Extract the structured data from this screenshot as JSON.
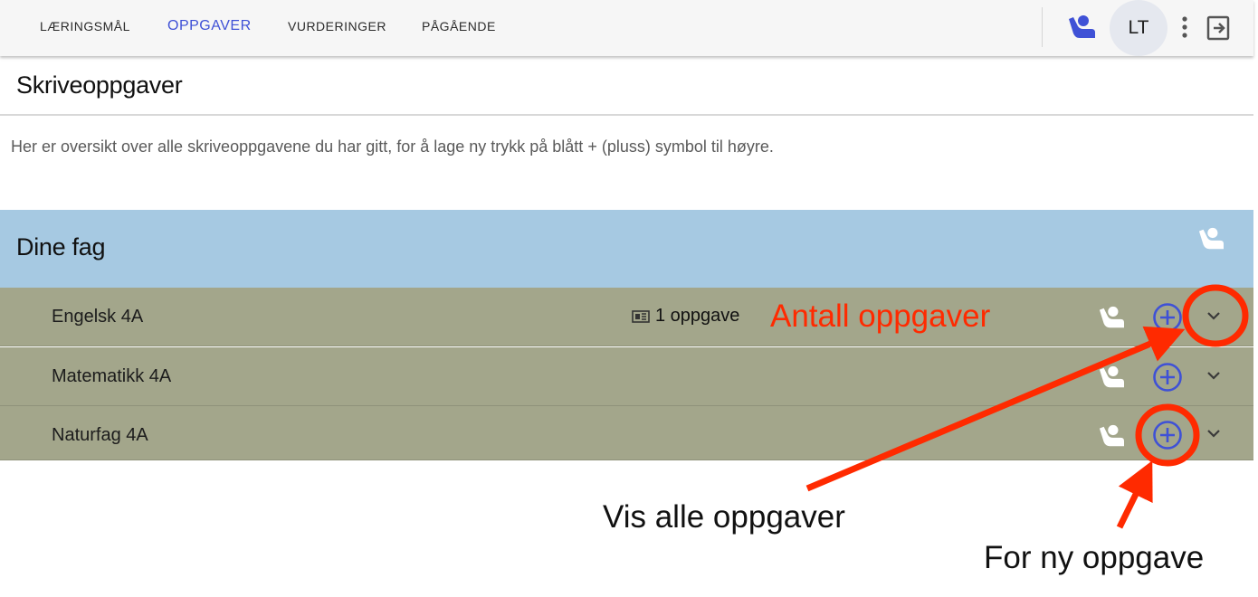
{
  "nav": {
    "tabs": [
      {
        "label": "LÆRINGSMÅL"
      },
      {
        "label": "OPPGAVER"
      },
      {
        "label": "VURDERINGER"
      },
      {
        "label": "PÅGÅENDE"
      }
    ],
    "avatar_initials": "LT"
  },
  "page": {
    "title": "Skriveoppgaver",
    "intro": "Her er oversikt over alle skriveoppgavene du har gitt, for å lage ny trykk på blått + (pluss) symbol til høyre."
  },
  "section": {
    "title": "Dine fag"
  },
  "subjects": [
    {
      "name": "Engelsk 4A",
      "task_count": "1 oppgave"
    },
    {
      "name": "Matematikk 4A",
      "task_count": ""
    },
    {
      "name": "Naturfag 4A",
      "task_count": ""
    }
  ],
  "annotations": {
    "count_label": "Antall oppgaver",
    "show_all_label": "Vis alle oppgaver",
    "new_task_label": "For ny oppgave",
    "color": "#ff2a00"
  },
  "colors": {
    "accent": "#3f51d6",
    "section_header": "#a6c9e2",
    "subject_row": "#a3a68b"
  },
  "icons": {
    "user": "user-recline-icon",
    "add": "add-circle-icon",
    "expand": "chevron-down-icon",
    "menu": "more-vert-icon",
    "logout": "logout-icon",
    "task": "task-icon"
  }
}
